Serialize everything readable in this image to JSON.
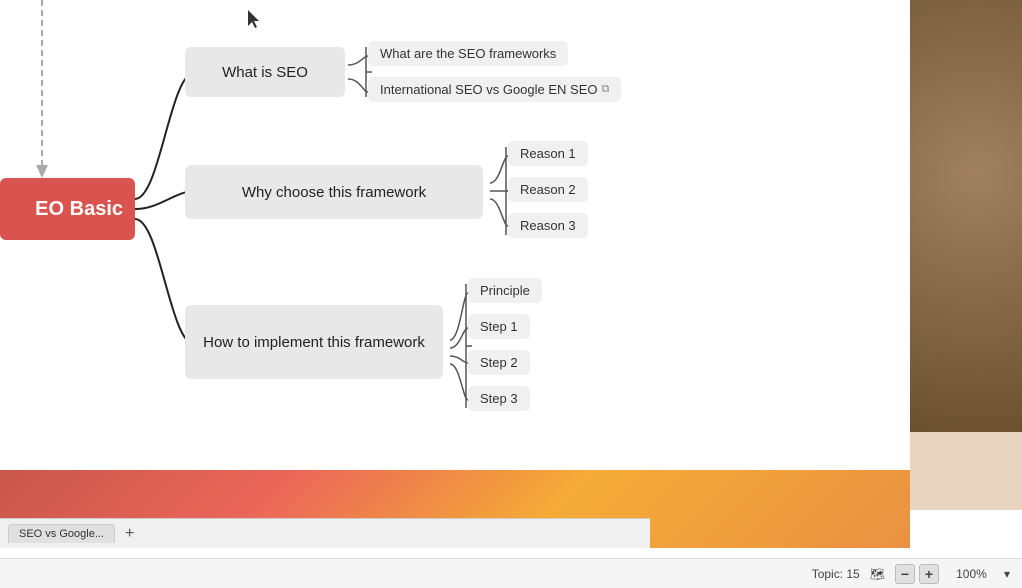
{
  "root": {
    "label": "EO Basic",
    "color": "#d9534f"
  },
  "nodes": {
    "what_is_seo": {
      "label": "What is SEO"
    },
    "why_choose": {
      "label": "Why choose this framework"
    },
    "how_to": {
      "label": "How to implement this framework"
    }
  },
  "leaves": {
    "what_is_seo_1": "What are the SEO frameworks",
    "what_is_seo_2": "International SEO vs Google EN SEO",
    "reason1": "Reason 1",
    "reason2": "Reason 2",
    "reason3": "Reason 3",
    "principle": "Principle",
    "step1": "Step 1",
    "step2": "Step 2",
    "step3": "Step 3"
  },
  "statusbar": {
    "topic_label": "Topic: 15",
    "zoom_label": "100%",
    "zoom_minus": "−",
    "zoom_plus": "+",
    "map_icon": "🗺"
  },
  "tabs": {
    "tab1_label": "SEO vs Google...",
    "add_label": "+"
  }
}
